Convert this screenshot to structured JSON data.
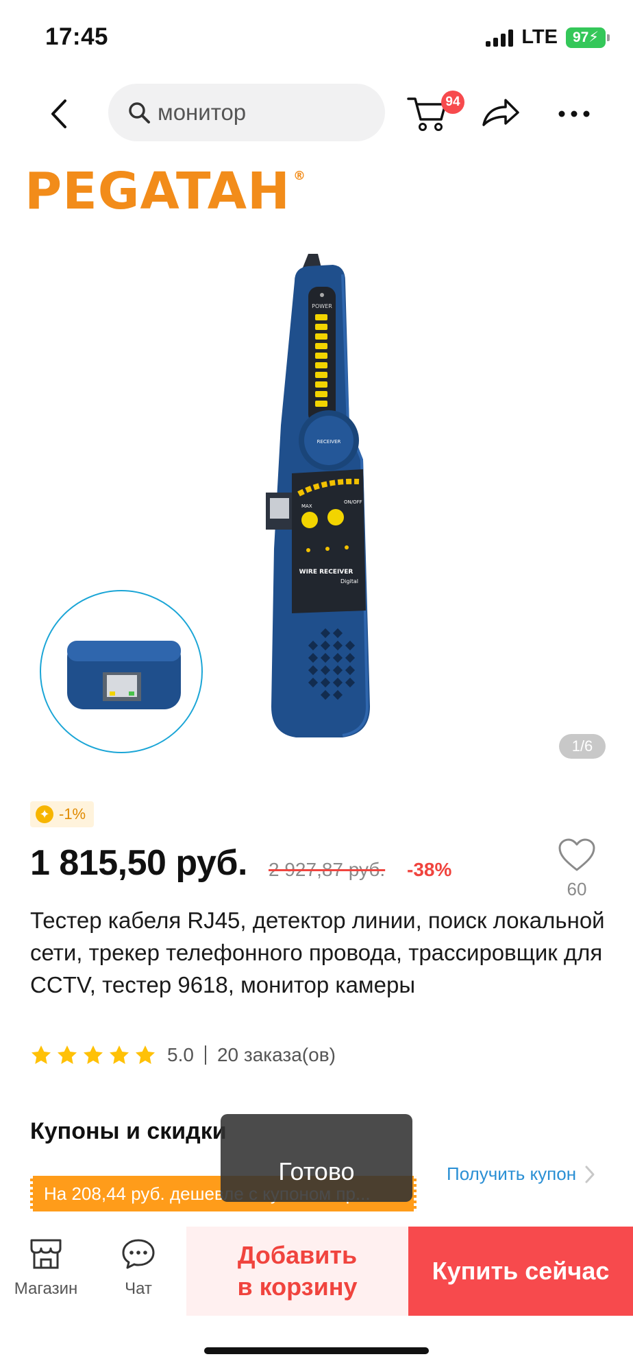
{
  "status_bar": {
    "time": "17:45",
    "network": "LTE",
    "battery": "97"
  },
  "topnav": {
    "search_placeholder": "монитор",
    "cart_badge": "94",
    "icons": [
      "back-icon",
      "search-icon",
      "cart-icon",
      "share-icon",
      "more-icon"
    ]
  },
  "gallery": {
    "brand": "PEGATAH",
    "brand_mark": "®",
    "counter": "1/6",
    "device_labels": {
      "power": "POWER",
      "receiver": "RECEIVER",
      "max": "MAX",
      "on_off": "ON/OFF",
      "model": "WIRE RECEIVER",
      "sub": "Digital"
    }
  },
  "product": {
    "discount_chip": "-1%",
    "price": "1 815,50 руб.",
    "old_price": "2 927,87 руб.",
    "percent_off": "-38%",
    "favorites": "60",
    "title": "Тестер кабеля RJ45, детектор линии, поиск локальной сети, трекер телефонного провода, трассировщик для CCTV, тестер 9618, монитор камеры",
    "rating": "5.0",
    "stars": 5,
    "orders": "20 заказа(ов)"
  },
  "coupons": {
    "title": "Купоны и скидки",
    "banner": "На 208,44 руб. дешевле с купоном пр...",
    "get_coupon": "Получить купон"
  },
  "toast": {
    "text": "Готово"
  },
  "bottom_bar": {
    "store_label": "Магазин",
    "chat_label": "Чат",
    "add_to_cart_line1": "Добавить",
    "add_to_cart_line2": "в корзину",
    "buy_now": "Купить сейчас"
  },
  "colors": {
    "accent": "#f74a4d",
    "coupon": "#ff9c1a",
    "link": "#2a8fd4",
    "brand": "#f28c1a"
  }
}
